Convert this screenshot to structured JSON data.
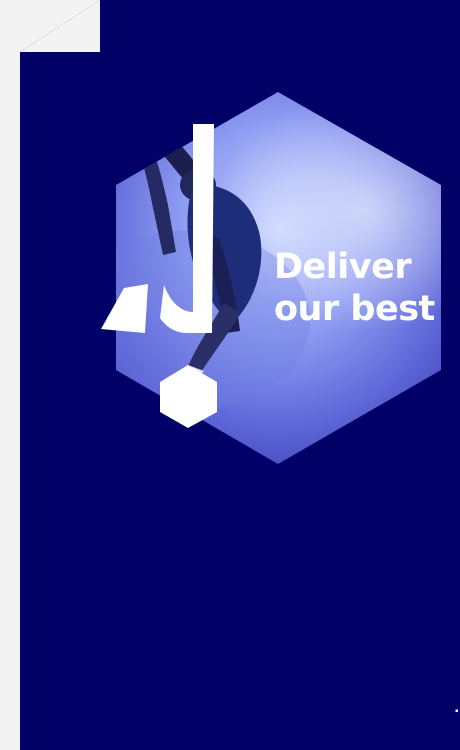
{
  "colors": {
    "background": "#f3f3f3",
    "panel": "#000066",
    "accent": "#2f46f2",
    "logo": "#ffffff"
  },
  "hero": {
    "tagline_line1": "Deliver",
    "tagline_line2": "our best",
    "image": "dancer-mid-leap-in-hexagon",
    "logo_icon": "jump-exclamation-logo-icon"
  }
}
